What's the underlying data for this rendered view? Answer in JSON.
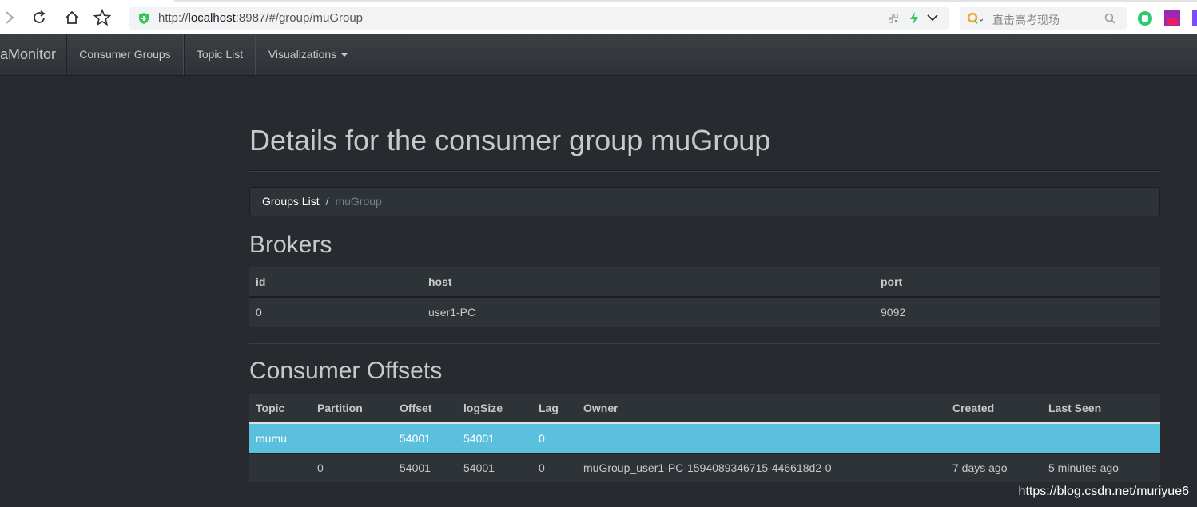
{
  "browser": {
    "url_prefix": "http://",
    "url_host": "localhost",
    "url_rest": ":8987/#/group/muGroup",
    "search_placeholder": "直击高考现场"
  },
  "navbar": {
    "brand": "aMonitor",
    "items": [
      {
        "label": "Consumer Groups"
      },
      {
        "label": "Topic List"
      },
      {
        "label": "Visualizations"
      }
    ]
  },
  "page": {
    "title": "Details for the consumer group muGroup",
    "breadcrumb": {
      "link": "Groups List",
      "separator": "/",
      "active": "muGroup"
    }
  },
  "brokers": {
    "title": "Brokers",
    "columns": [
      "id",
      "host",
      "port"
    ],
    "rows": [
      [
        "0",
        "user1-PC",
        "9092"
      ]
    ]
  },
  "offsets": {
    "title": "Consumer Offsets",
    "columns": [
      "Topic",
      "Partition",
      "Offset",
      "logSize",
      "Lag",
      "Owner",
      "Created",
      "Last Seen"
    ],
    "summary_row": [
      "mumu",
      "",
      "54001",
      "54001",
      "0",
      "",
      "",
      ""
    ],
    "rows": [
      [
        "",
        "0",
        "54001",
        "54001",
        "0",
        "muGroup_user1-PC-1594089346715-446618d2-0",
        "7 days ago",
        "5 minutes ago"
      ]
    ]
  },
  "watermark": "https://blog.csdn.net/muriyue6",
  "colors": {
    "background": "#272b30",
    "info_row": "#5bc0de",
    "secure_badge": "#34c759"
  }
}
